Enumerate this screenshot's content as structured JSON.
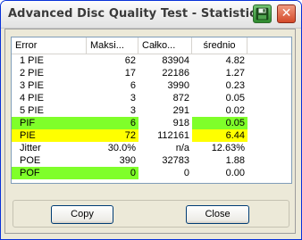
{
  "window": {
    "title": "Advanced Disc Quality Test - Statistics",
    "save_icon": "floppy-disk-icon",
    "close_icon": "close-icon",
    "accent_colors": {
      "green": "#7fff2a",
      "yellow": "#ffff00",
      "close": "#d44a2a"
    }
  },
  "table": {
    "columns": [
      "Error",
      "Maksi...",
      "Całko...",
      "średnio"
    ],
    "rows": [
      {
        "name": "1 PIE",
        "max": "62",
        "total": "83904",
        "avg": "4.82",
        "highlight": []
      },
      {
        "name": "2 PIE",
        "max": "17",
        "total": "22186",
        "avg": "1.27",
        "highlight": []
      },
      {
        "name": "3 PIE",
        "max": "6",
        "total": "3990",
        "avg": "0.23",
        "highlight": []
      },
      {
        "name": "4 PIE",
        "max": "3",
        "total": "872",
        "avg": "0.05",
        "highlight": []
      },
      {
        "name": "5 PIE",
        "max": "3",
        "total": "291",
        "avg": "0.02",
        "highlight": []
      },
      {
        "name": "PIF",
        "max": "6",
        "total": "918",
        "avg": "0.05",
        "highlight": [
          "name:green",
          "max:green",
          "avg:green"
        ]
      },
      {
        "name": "PIE",
        "max": "72",
        "total": "112161",
        "avg": "6.44",
        "highlight": [
          "name:yellow",
          "max:yellow",
          "avg:yellow"
        ]
      },
      {
        "name": "Jitter",
        "max": "30.0%",
        "total": "n/a",
        "avg": "12.63%",
        "highlight": []
      },
      {
        "name": "POE",
        "max": "390",
        "total": "32783",
        "avg": "1.88",
        "highlight": []
      },
      {
        "name": "POF",
        "max": "0",
        "total": "0",
        "avg": "0.00",
        "highlight": [
          "name:green",
          "max:green"
        ]
      }
    ]
  },
  "buttons": {
    "copy": "Copy",
    "close": "Close"
  }
}
